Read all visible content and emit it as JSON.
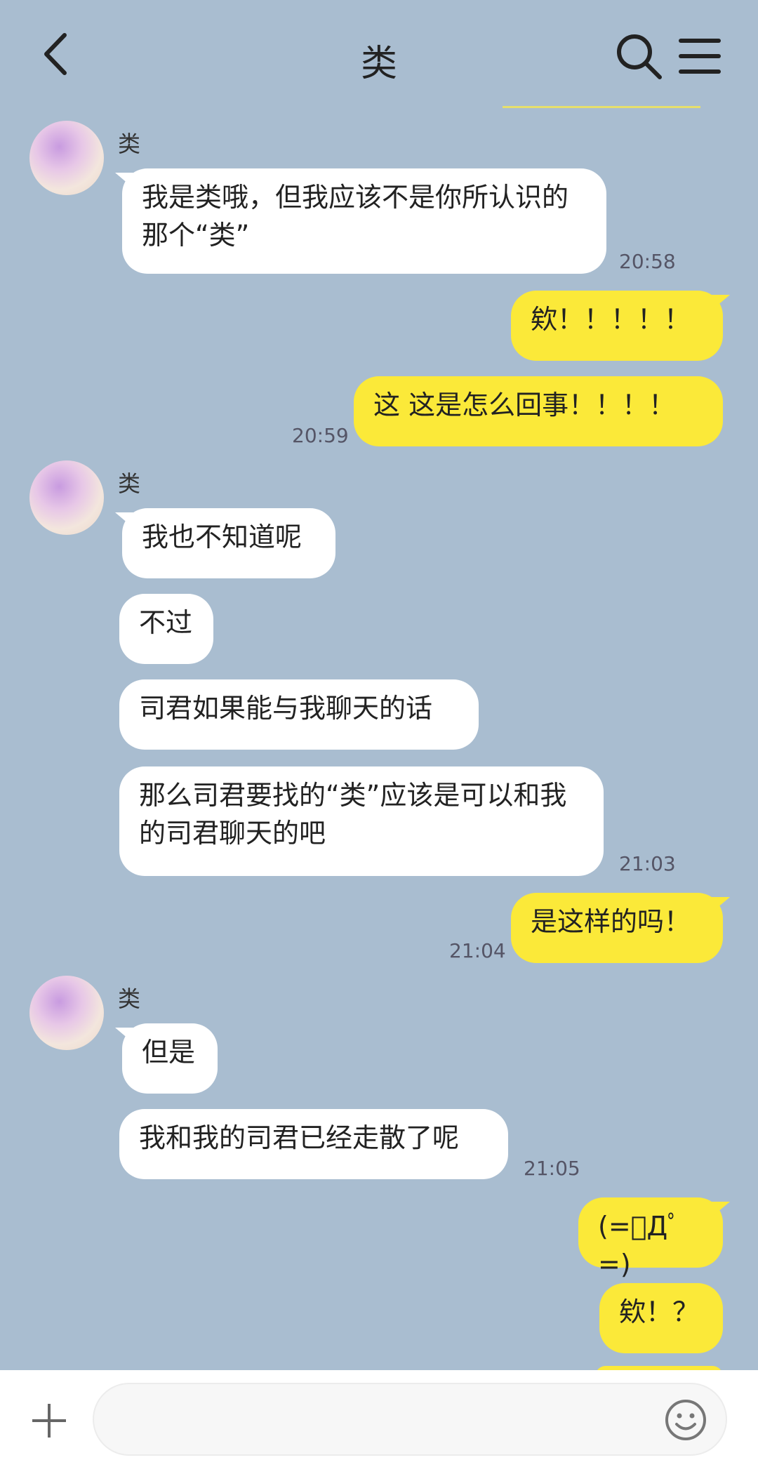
{
  "header": {
    "title": "类"
  },
  "messages": [
    {
      "text": "我是类哦，但我应该不是你所认识的那个“类”",
      "time": "20:58"
    },
    {
      "text": "欸！！！！！"
    },
    {
      "text": "这 这是怎么回事！！！！",
      "time": "20:59"
    },
    {
      "text": "我也不知道呢"
    },
    {
      "text": "不过"
    },
    {
      "text": "司君如果能与我聊天的话"
    },
    {
      "text": "那么司君要找的“类”应该是可以和我的司君聊天的吧",
      "time": "21:03"
    },
    {
      "text": "是这样的吗！",
      "time": "21:04"
    },
    {
      "text": "但是"
    },
    {
      "text": "我和我的司君已经走散了呢",
      "time": "21:05"
    },
    {
      "text": "(=ﾟДﾟ=)"
    },
    {
      "text": "欸！？"
    }
  ],
  "sender_name": "类",
  "input": {
    "placeholder": ""
  },
  "colors": {
    "background": "#a9bdd0",
    "incoming": "#ffffff",
    "outgoing": "#fbe939"
  },
  "icons": [
    "back-arrow-icon",
    "search-icon",
    "menu-icon",
    "plus-icon",
    "emoji-icon"
  ]
}
